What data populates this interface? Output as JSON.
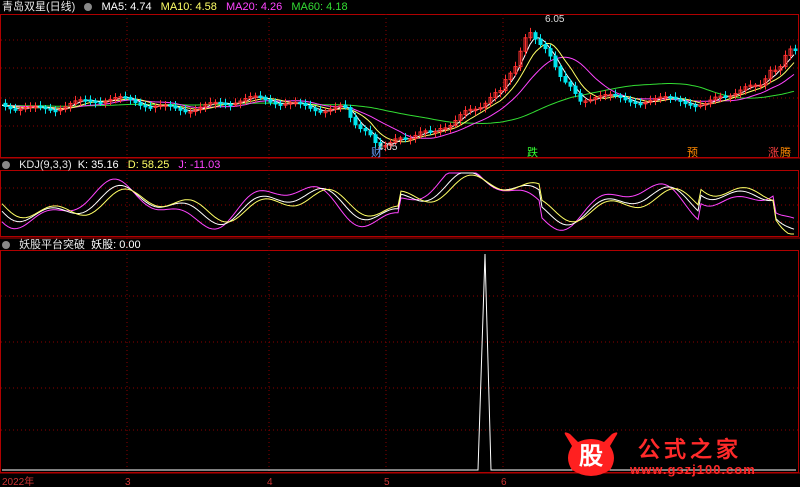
{
  "main_panel": {
    "title": "青岛双星(日线)",
    "indicators": [
      {
        "label": "MA5: 4.74",
        "color": "#ffffff"
      },
      {
        "label": "MA10: 4.58",
        "color": "#ffff66"
      },
      {
        "label": "MA20: 4.26",
        "color": "#ff44ff"
      },
      {
        "label": "MA60: 4.18",
        "color": "#33dd33"
      }
    ],
    "high_marker": "6.05",
    "low_marker": "4.05",
    "signal_labels": [
      {
        "text": "财",
        "color": "#6aa0ff"
      },
      {
        "text": "跌",
        "color": "#33ff33"
      },
      {
        "text": "预",
        "color": "#ff8800"
      },
      {
        "text": "涨",
        "color": "#ff4040"
      },
      {
        "text": "腾",
        "color": "#ff8800"
      }
    ]
  },
  "kdj_panel": {
    "title": "KDJ(9,3,3)",
    "indicators": [
      {
        "label": "K: 35.16",
        "color": "#ffffff"
      },
      {
        "label": "D: 58.25",
        "color": "#ffff66"
      },
      {
        "label": "J: -11.03",
        "color": "#ff44ff"
      }
    ]
  },
  "signal_panel": {
    "title": "妖股平台突破",
    "indicators": [
      {
        "label": "妖股: 0.00",
        "color": "#ffffff"
      }
    ]
  },
  "x_axis_labels": [
    "2022年",
    "3",
    "4",
    "5",
    "6"
  ],
  "watermark": {
    "text": "公式之家",
    "url": "www.gszj100.com",
    "badge": "股"
  },
  "colors": {
    "up": "#ff3030",
    "down": "#00e5ee",
    "grid": "#8b0000",
    "divider": "#b00000"
  }
}
